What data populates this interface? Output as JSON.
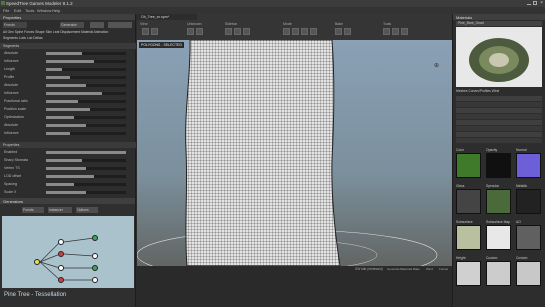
{
  "app": {
    "title": "SpeedTree Games Modeler 8.1.2"
  },
  "menu": [
    "File",
    "Edit",
    "Tools",
    "Window",
    "Help"
  ],
  "toolbar": {
    "tab": "Oh_Tree_xx.spm*",
    "groups": [
      "View",
      "Unknown",
      "Sidebar",
      "Mode",
      "Bake",
      "Tools"
    ]
  },
  "properties": {
    "title": "Properties",
    "mode_button": "Generator",
    "node_name": "Fronds",
    "tabs": [
      "All",
      "Gen",
      "Spine",
      "Forces",
      "Shape",
      "Skin",
      "Leaf",
      "Displacement",
      "Material",
      "Animation"
    ],
    "subtabs": [
      "Segments",
      "Lods",
      "Lod Deltas"
    ],
    "section_generation": "Segments",
    "rows": [
      {
        "label": "Absolute",
        "value": 0.45
      },
      {
        "label": "Influence",
        "value": 0.6
      },
      {
        "label": "Length",
        "value": 0.2
      },
      {
        "label": "Profile",
        "value": 0.3
      },
      {
        "label": "Absolute",
        "value": 0.5
      },
      {
        "label": "Influence",
        "value": 0.7
      },
      {
        "label": "Fractional ratio",
        "value": 0.4
      },
      {
        "label": "Position scale",
        "value": 0.55
      },
      {
        "label": "Optimization",
        "value": 0.35
      },
      {
        "label": "Absolute",
        "value": 0.5
      },
      {
        "label": "Influence",
        "value": 0.3
      }
    ],
    "section_props": "Properties",
    "props_rows": [
      {
        "label": "Enabled",
        "value": 1.0
      },
      {
        "label": "Sharp Stomata",
        "value": 0.45
      },
      {
        "label": "Vertex TS",
        "value": 0.5
      },
      {
        "label": "LOD offset",
        "value": 0.6
      },
      {
        "label": "Spacing",
        "value": 0.35
      },
      {
        "label": "Scale X",
        "value": 0.5
      },
      {
        "label": "Scale Y",
        "value": 0.5
      }
    ]
  },
  "generators": {
    "title": "Generators",
    "buttons": [
      "Fronds",
      "Instancer",
      "Options"
    ],
    "caption": "Pine Tree - Tessellation"
  },
  "viewport": {
    "label": "POLYGONS - SELECTED"
  },
  "assets": {
    "title": "Materials",
    "name": "Pine_Bark_Gnarl",
    "tabs": [
      "Meshes",
      "Curves/Profiles",
      "Wind"
    ],
    "list_count": 8
  },
  "textures": {
    "labels": [
      "Color",
      "Opacity",
      "Normal",
      "Gloss",
      "Specular",
      "Metallic",
      "Subsurface",
      "Subsurface Map",
      "AO",
      "Height",
      "Custom",
      "Custom"
    ],
    "colors": [
      "#3f7a2a",
      "#101010",
      "#6c5fd8",
      "#444444",
      "#4a6a3a",
      "#222222",
      "#b8c0a0",
      "#e8e8e8",
      "#606060",
      "#d0d0d0",
      "#cccccc",
      "#c8c8c8"
    ]
  },
  "status": {
    "left": "SW idle (reviewed)",
    "buttons": [
      "Generate",
      "Materials",
      "Bake",
      "Wind",
      "Forces"
    ]
  }
}
